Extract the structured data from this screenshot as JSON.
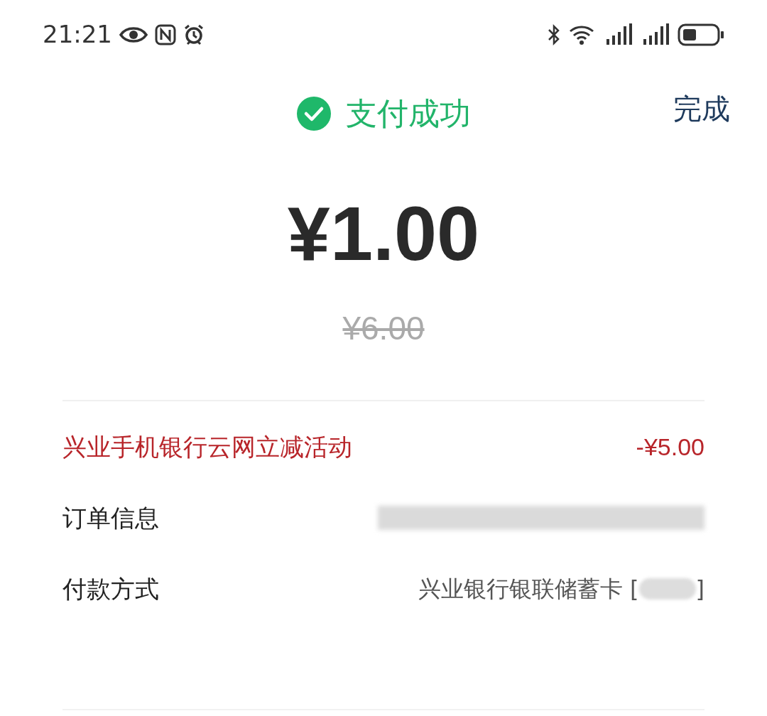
{
  "status_bar": {
    "time": "21:21"
  },
  "header": {
    "status": "支付成功",
    "done_button": "完成"
  },
  "amount": {
    "paid": "¥1.00",
    "original": "¥6.00",
    "original_struck": true
  },
  "details": [
    {
      "kind": "discount",
      "label": "兴业手机银行云网立减活动",
      "value": "-¥5.00"
    },
    {
      "kind": "redacted",
      "label": "订单信息"
    },
    {
      "kind": "masked",
      "label": "付款方式",
      "value": "兴业银行银联储蓄卡 [",
      "value_end": "]"
    }
  ]
}
